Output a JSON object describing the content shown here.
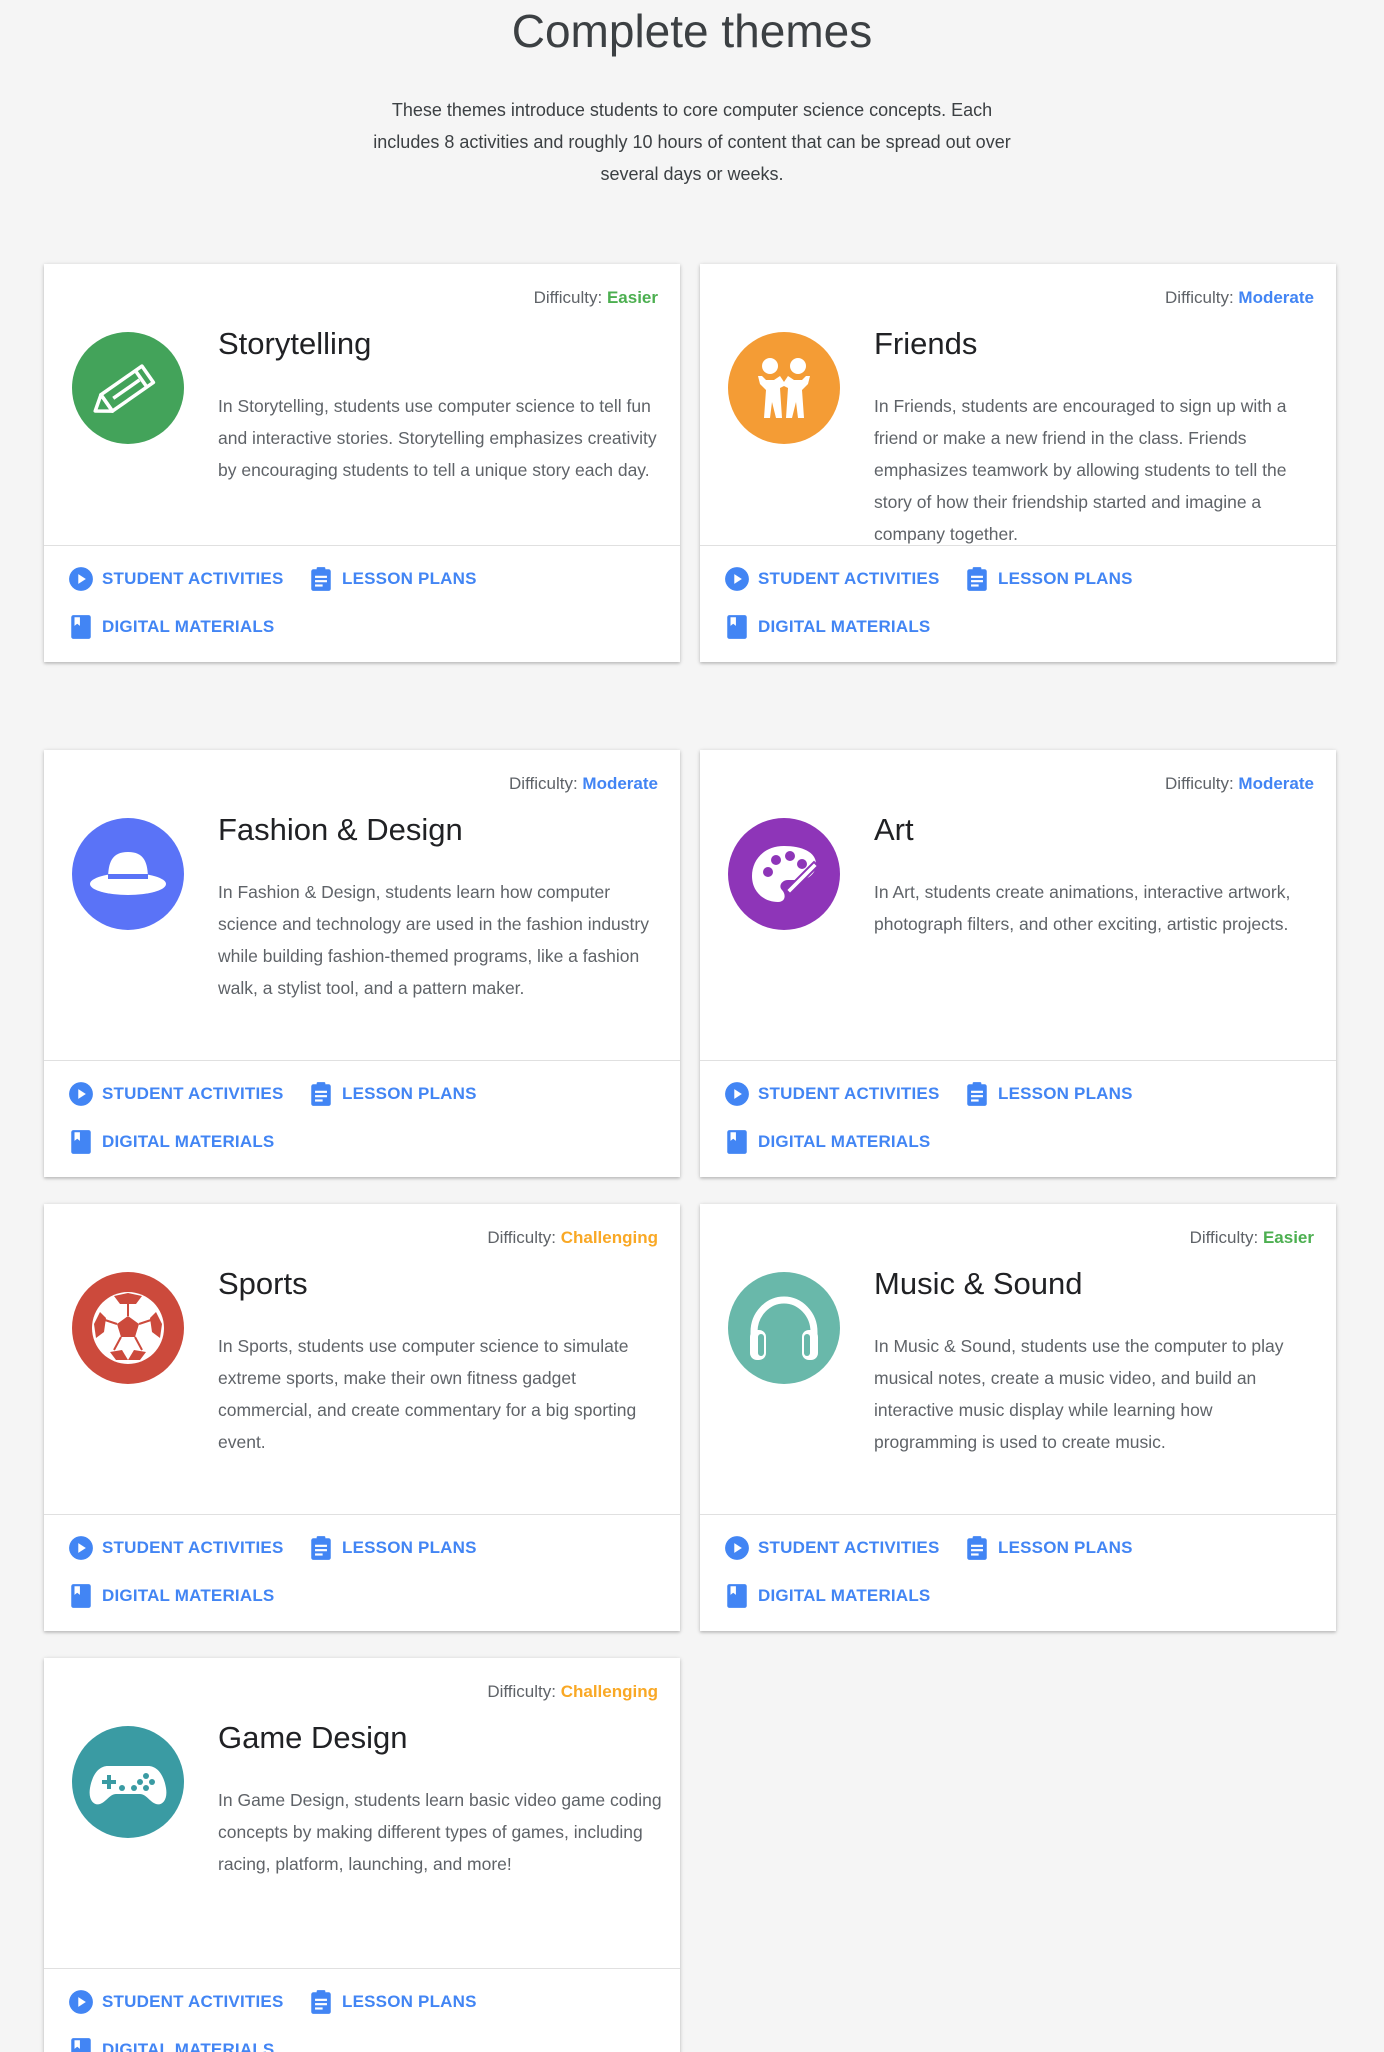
{
  "header": {
    "title": "Complete themes",
    "intro": "These themes introduce students to core computer science concepts. Each includes 8 activities and roughly 10 hours of content that can be spread out over several days or weeks."
  },
  "colors": {
    "link": "#4285f4",
    "easier": "#4caf50",
    "moderate": "#4285f4",
    "challenging": "#f9a825"
  },
  "link_labels": {
    "student_activities": "STUDENT ACTIVITIES",
    "lesson_plans": "LESSON PLANS",
    "digital_materials": "DIGITAL MATERIALS",
    "difficulty_label": "Difficulty:"
  },
  "themes": [
    {
      "title": "Storytelling",
      "difficulty": "Easier",
      "icon": "pencil-icon",
      "icon_color": "#43a35a",
      "description": "In Storytelling, students use computer science to tell fun and interactive stories. Storytelling emphasizes creativity by encouraging students to tell a unique story each day."
    },
    {
      "title": "Friends",
      "difficulty": "Moderate",
      "icon": "friends-icon",
      "icon_color": "#f49c35",
      "description": "In Friends, students are encouraged to sign up with a friend or make a new friend in the class. Friends emphasizes teamwork by allowing students to tell the story of how their friendship started and imagine a company together."
    },
    {
      "title": "Fashion & Design",
      "difficulty": "Moderate",
      "icon": "hat-icon",
      "icon_color": "#5a73f7",
      "description": "In Fashion & Design, students learn how computer science and technology are used in the fashion industry while building fashion-themed programs, like a fashion walk, a stylist tool, and a pattern maker."
    },
    {
      "title": "Art",
      "difficulty": "Moderate",
      "icon": "palette-icon",
      "icon_color": "#8e35b8",
      "description": "In Art, students create animations, interactive artwork, photograph filters, and other exciting, artistic projects."
    },
    {
      "title": "Sports",
      "difficulty": "Challenging",
      "icon": "soccer-ball-icon",
      "icon_color": "#cc4a3c",
      "description": "In Sports, students use computer science to simulate extreme sports, make their own fitness gadget commercial, and create commentary for a big sporting event."
    },
    {
      "title": "Music & Sound",
      "difficulty": "Easier",
      "icon": "headphones-icon",
      "icon_color": "#69b8aa",
      "description": "In Music & Sound, students use the computer to play musical notes, create a music video, and build an interactive music display while learning how programming is used to create music."
    },
    {
      "title": "Game Design",
      "difficulty": "Challenging",
      "icon": "gamepad-icon",
      "icon_color": "#3a9ba3",
      "description": "In Game Design, students learn basic video game coding concepts by making different types of games, including racing, platform, launching, and more!"
    }
  ]
}
